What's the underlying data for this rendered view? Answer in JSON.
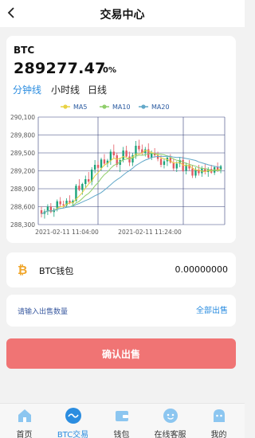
{
  "header": {
    "title": "交易中心"
  },
  "ticker": {
    "symbol": "BTC",
    "price": "289277.47",
    "change": "0%"
  },
  "intervals": [
    {
      "label": "分钟线",
      "active": true
    },
    {
      "label": "小时线",
      "active": false
    },
    {
      "label": "日线",
      "active": false
    }
  ],
  "chart_data": {
    "type": "candlestick",
    "series_legend": [
      {
        "name": "MA5",
        "color": "#e8d243"
      },
      {
        "name": "MA10",
        "color": "#8fce6a"
      },
      {
        "name": "MA20",
        "color": "#62a8c9"
      }
    ],
    "y_ticks": [
      "290,100",
      "289,800",
      "289,500",
      "289,200",
      "288,900",
      "288,600",
      "288,300"
    ],
    "ylim": [
      288300,
      290100
    ],
    "x_ticks": [
      "2021-02-11 11:04:00",
      "2021-02-11 11:24:00"
    ],
    "grid": true,
    "up_color": "#1ba37a",
    "down_color": "#e25a63",
    "ohlc": [
      [
        288540,
        288600,
        288420,
        288480
      ],
      [
        288480,
        288560,
        288400,
        288520
      ],
      [
        288520,
        288640,
        288460,
        288600
      ],
      [
        288600,
        288660,
        288490,
        288510
      ],
      [
        288510,
        288580,
        288430,
        288550
      ],
      [
        288550,
        288720,
        288520,
        288690
      ],
      [
        288690,
        288760,
        288600,
        288640
      ],
      [
        288640,
        288700,
        288580,
        288620
      ],
      [
        288620,
        288740,
        288590,
        288700
      ],
      [
        288700,
        288790,
        288640,
        288660
      ],
      [
        288660,
        288720,
        288600,
        288700
      ],
      [
        288700,
        288980,
        288680,
        288950
      ],
      [
        288950,
        289060,
        288860,
        288880
      ],
      [
        288880,
        289000,
        288800,
        288980
      ],
      [
        288980,
        289120,
        288920,
        289060
      ],
      [
        289060,
        289180,
        288990,
        289020
      ],
      [
        289020,
        289260,
        288960,
        289220
      ],
      [
        289220,
        289380,
        289160,
        289300
      ],
      [
        289300,
        289360,
        289220,
        289250
      ],
      [
        289250,
        289420,
        289200,
        289390
      ],
      [
        289390,
        289480,
        289280,
        289320
      ],
      [
        289320,
        289400,
        289260,
        289370
      ],
      [
        289370,
        289560,
        289300,
        289520
      ],
      [
        289520,
        289640,
        289400,
        289460
      ],
      [
        289460,
        289500,
        289260,
        289300
      ],
      [
        289300,
        289420,
        289180,
        289380
      ],
      [
        289380,
        289600,
        289340,
        289540
      ],
      [
        289540,
        289620,
        289420,
        289440
      ],
      [
        289440,
        289520,
        289280,
        289340
      ],
      [
        289340,
        289500,
        289280,
        289460
      ],
      [
        289460,
        289700,
        289400,
        289620
      ],
      [
        289620,
        289720,
        289520,
        289560
      ],
      [
        289560,
        289640,
        289460,
        289500
      ],
      [
        289500,
        289600,
        289440,
        289560
      ],
      [
        289560,
        289660,
        289400,
        289420
      ],
      [
        289420,
        289540,
        289380,
        289500
      ],
      [
        289500,
        289580,
        289420,
        289460
      ],
      [
        289460,
        289520,
        289360,
        289400
      ],
      [
        289400,
        289460,
        289260,
        289300
      ],
      [
        289300,
        289400,
        289240,
        289360
      ],
      [
        289360,
        289460,
        289280,
        289420
      ],
      [
        289420,
        289480,
        289320,
        289340
      ],
      [
        289340,
        289400,
        289200,
        289240
      ],
      [
        289240,
        289360,
        289180,
        289320
      ],
      [
        289320,
        289420,
        289260,
        289380
      ],
      [
        289380,
        289440,
        289180,
        289200
      ],
      [
        289200,
        289340,
        289140,
        289300
      ],
      [
        289300,
        289380,
        289200,
        289240
      ],
      [
        289240,
        289300,
        289080,
        289120
      ],
      [
        289120,
        289260,
        289080,
        289220
      ],
      [
        289220,
        289300,
        289120,
        289160
      ],
      [
        289160,
        289280,
        289100,
        289240
      ],
      [
        289240,
        289320,
        289140,
        289180
      ],
      [
        289180,
        289260,
        289100,
        289230
      ],
      [
        289230,
        289300,
        289150,
        289170
      ],
      [
        289170,
        289280,
        289130,
        289260
      ],
      [
        289260,
        289340,
        289180,
        289220
      ],
      [
        289220,
        289300,
        289160,
        289277.47
      ]
    ]
  },
  "wallet": {
    "icon": "bitcoin-icon",
    "name": "BTC钱包",
    "balance": "0.00000000"
  },
  "sell": {
    "placeholder": "请输入出售数量",
    "all_label": "全部出售"
  },
  "confirm_label": "确认出售",
  "tabbar": [
    {
      "label": "首页",
      "icon": "home-icon",
      "active": false
    },
    {
      "label": "BTC交易",
      "icon": "trade-wave-icon",
      "active": true
    },
    {
      "label": "钱包",
      "icon": "wallet-icon",
      "active": false
    },
    {
      "label": "在线客服",
      "icon": "customer-service-icon",
      "active": false
    },
    {
      "label": "我的",
      "icon": "profile-icon",
      "active": false
    }
  ]
}
